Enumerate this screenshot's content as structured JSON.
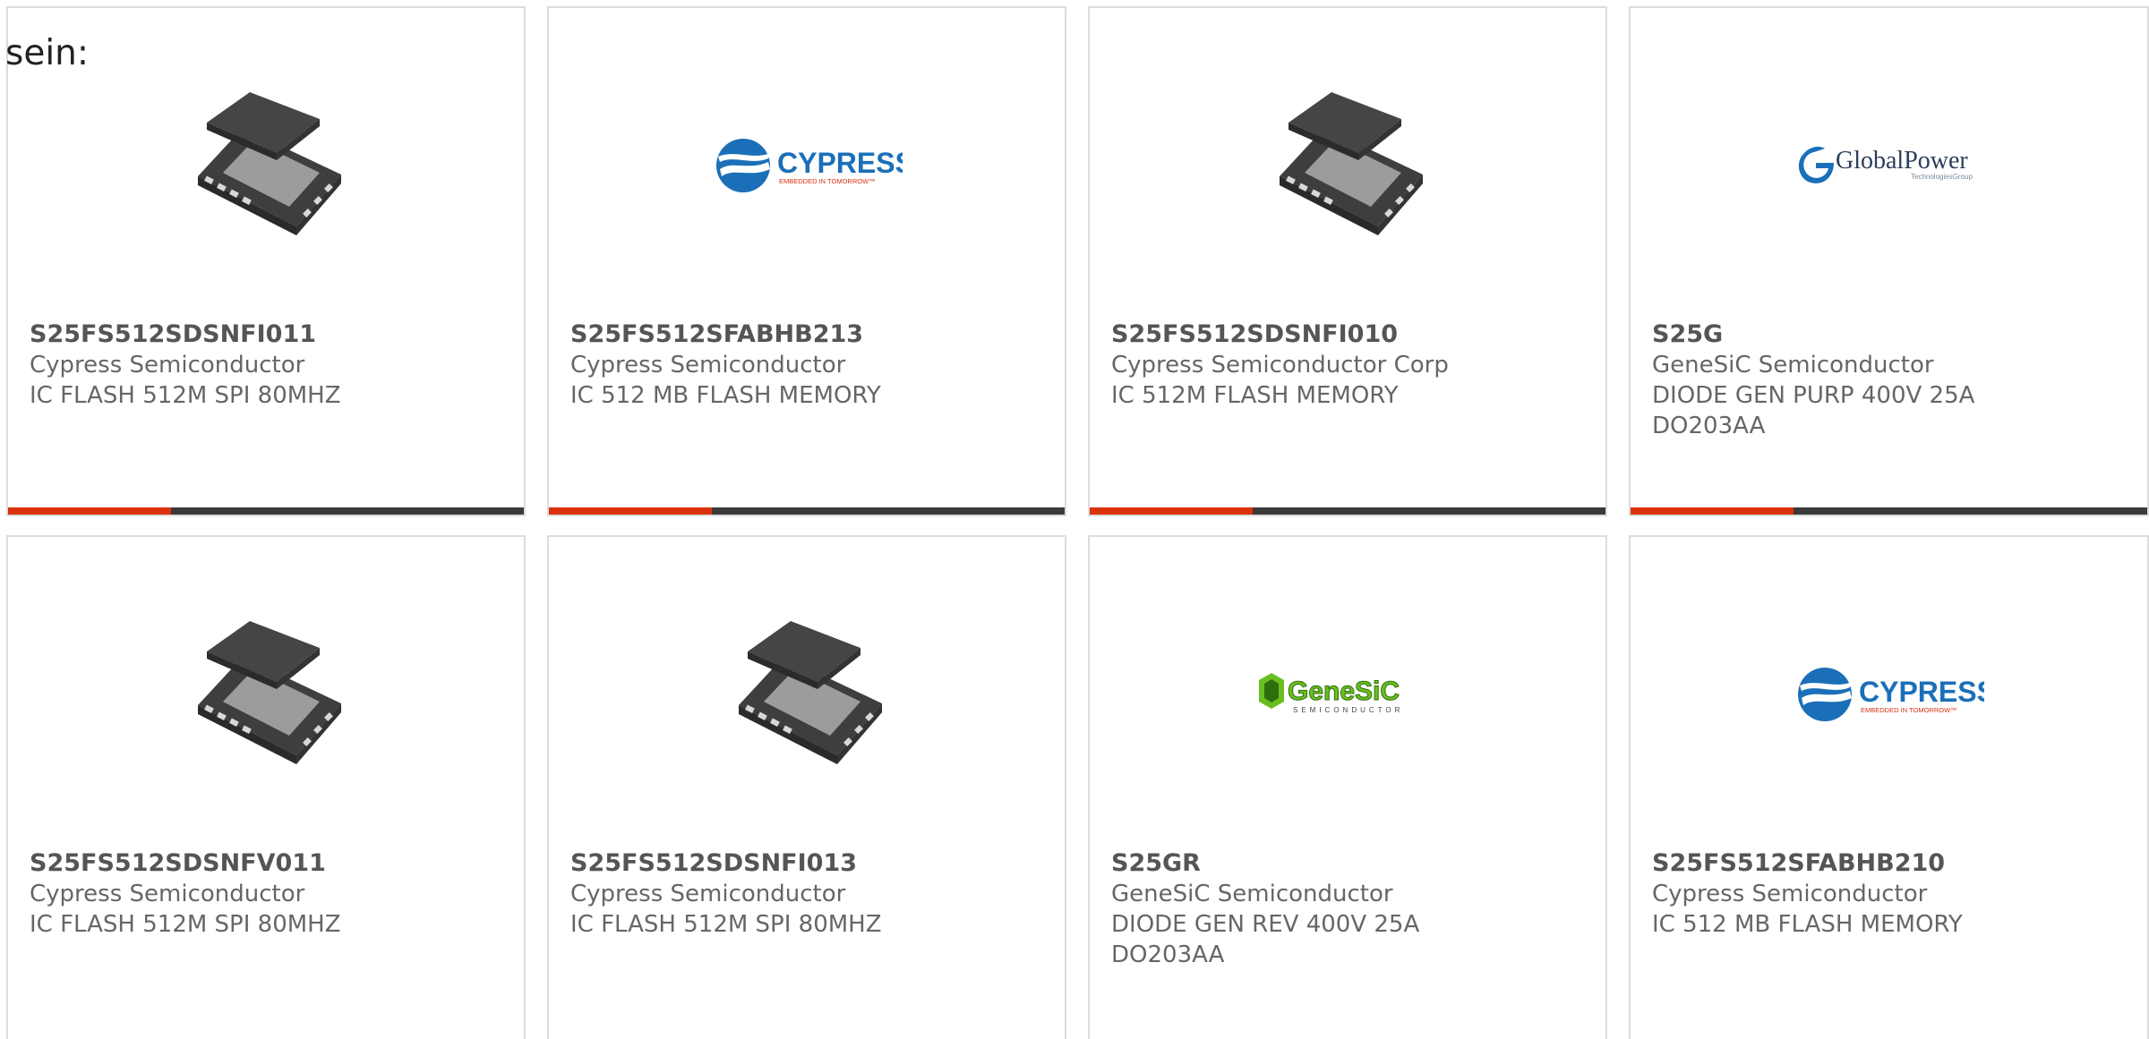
{
  "intro_text": "sein:",
  "colors": {
    "accent_bar": "#d9310c",
    "dark_bar": "#3a3a3a",
    "cypress_blue": "#1b6fb8",
    "cypress_red": "#d9310c",
    "genesic_green": "#6abf1e"
  },
  "products": [
    {
      "part_number": "S25FS512SDSNFI011",
      "manufacturer": "Cypress Semiconductor",
      "description": "IC FLASH 512M SPI 80MHZ",
      "image": "chip-package"
    },
    {
      "part_number": "S25FS512SFABHB213",
      "manufacturer": "Cypress Semiconductor",
      "description": "IC 512 MB FLASH MEMORY",
      "image": "cypress-logo",
      "logo": {
        "name": "CYPRESS",
        "tagline": "EMBEDDED IN TOMORROW™"
      }
    },
    {
      "part_number": "S25FS512SDSNFI010",
      "manufacturer": "Cypress Semiconductor Corp",
      "description": "IC 512M FLASH MEMORY",
      "image": "chip-package"
    },
    {
      "part_number": "S25G",
      "manufacturer": "GeneSiC Semiconductor",
      "description": "DIODE GEN PURP 400V 25A DO203AA",
      "image": "globalpower-logo",
      "logo": {
        "name": "GlobalPower",
        "tagline": "TechnologiesGroup"
      }
    },
    {
      "part_number": "S25FS512SDSNFV011",
      "manufacturer": "Cypress Semiconductor",
      "description": "IC FLASH 512M SPI 80MHZ",
      "image": "chip-package"
    },
    {
      "part_number": "S25FS512SDSNFI013",
      "manufacturer": "Cypress Semiconductor",
      "description": "IC FLASH 512M SPI 80MHZ",
      "image": "chip-package"
    },
    {
      "part_number": "S25GR",
      "manufacturer": "GeneSiC Semiconductor",
      "description": "DIODE GEN REV 400V 25A DO203AA",
      "image": "genesic-logo",
      "logo": {
        "name": "GeneSiC",
        "tagline": "SEMICONDUCTOR"
      }
    },
    {
      "part_number": "S25FS512SFABHB210",
      "manufacturer": "Cypress Semiconductor",
      "description": "IC 512 MB FLASH MEMORY",
      "image": "cypress-logo",
      "logo": {
        "name": "CYPRESS",
        "tagline": "EMBEDDED IN TOMORROW™"
      }
    }
  ]
}
